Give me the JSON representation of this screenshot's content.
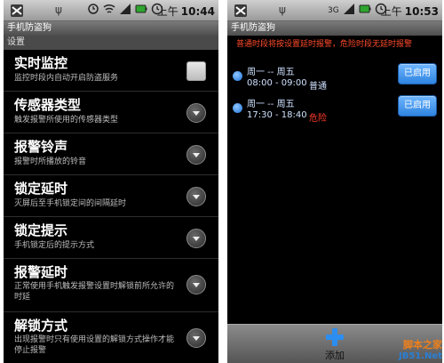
{
  "left": {
    "status": {
      "ampm": "上午",
      "time": "10:44"
    },
    "app_title": "手机防盗狗",
    "section": "设置",
    "prefs": [
      {
        "title": "实时监控",
        "summary": "监控时段内自动开启防盗服务",
        "control": "checkbox",
        "checked": true
      },
      {
        "title": "传感器类型",
        "summary": "触发报警所使用的传感器类型",
        "control": "dropdown"
      },
      {
        "title": "报警铃声",
        "summary": "报警时所播放的铃音",
        "control": "dropdown"
      },
      {
        "title": "锁定延时",
        "summary": "灭屏后至手机锁定间的间隔延时",
        "control": "dropdown"
      },
      {
        "title": "锁定提示",
        "summary": "手机锁定后的提示方式",
        "control": "dropdown"
      },
      {
        "title": "报警延时",
        "summary": "正常使用手机触发报警设置时解锁前所允许的时延",
        "control": "dropdown"
      },
      {
        "title": "解锁方式",
        "summary": "出现报警时只有使用设置的解锁方式操作才能停止报警",
        "control": "dropdown"
      }
    ]
  },
  "right": {
    "status": {
      "ampm": "上午",
      "time": "10:53"
    },
    "app_title": "手机防盗狗",
    "warning": "普通时段将按设置延时报警，危险时段无延时报警",
    "periods": [
      {
        "days": "周一 -- 周五",
        "time": "08:00 - 09:00",
        "level": "普通",
        "level_color": "#cfe1ff",
        "button": "已启用"
      },
      {
        "days": "周一 -- 周五",
        "time": "17:30 - 18:40",
        "level": "危险",
        "level_color": "#ff3b2a",
        "button": "已启用"
      }
    ],
    "add_label": "添加"
  },
  "watermark": {
    "line1": "脚本之家",
    "line2": "JB51.Net"
  }
}
